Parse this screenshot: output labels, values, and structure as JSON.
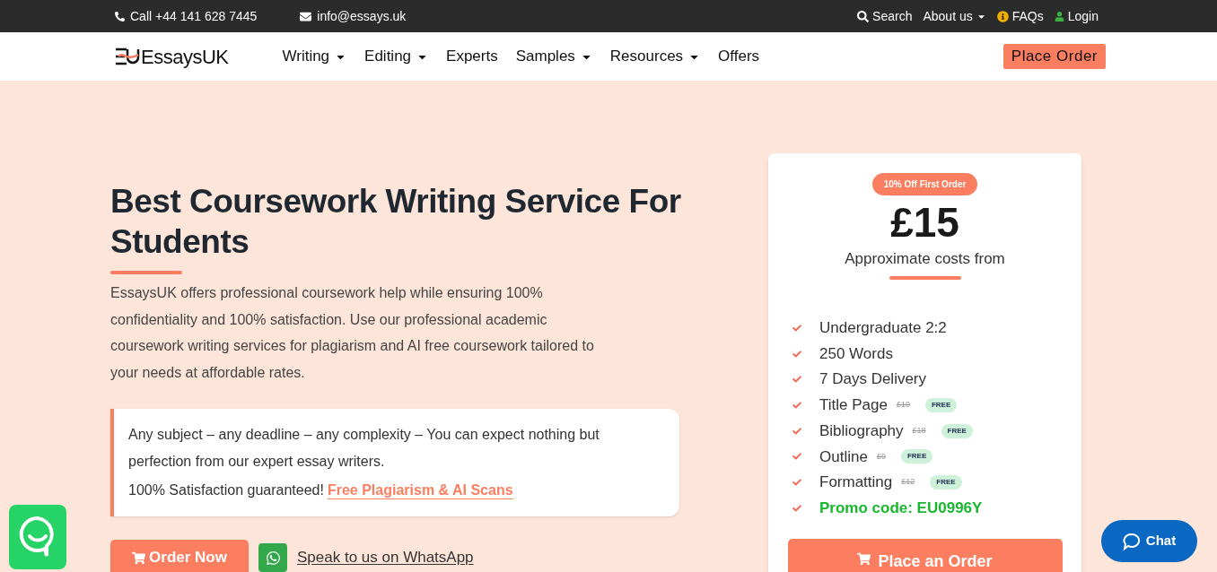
{
  "topbar": {
    "phone": "Call +44 141 628 7445",
    "email": "info@essays.uk",
    "links": [
      {
        "kind": "search",
        "label": "Search"
      },
      {
        "kind": "dropdown",
        "label": "About us"
      },
      {
        "kind": "info",
        "label": "FAQs"
      },
      {
        "kind": "user",
        "label": "Login"
      }
    ]
  },
  "nav": {
    "logo": "EssaysUK",
    "items": [
      {
        "label": "Writing",
        "dropdown": true
      },
      {
        "label": "Editing",
        "dropdown": true
      },
      {
        "label": "Experts",
        "dropdown": false
      },
      {
        "label": "Samples",
        "dropdown": true
      },
      {
        "label": "Resources",
        "dropdown": true
      },
      {
        "label": "Offers",
        "dropdown": false
      }
    ],
    "cta": "Place Order"
  },
  "hero": {
    "title": "Best Coursework Writing Service For Students",
    "intro": "EssaysUK offers professional coursework help while ensuring 100% confidentiality and 100% satisfaction. Use our professional academic coursework writing services for plagiarism and AI free coursework tailored to your needs at affordable rates.",
    "callout": "Any subject – any deadline – any complexity – You can expect nothing but perfection from our expert essay writers.",
    "guarantee": "100% Satisfaction guaranteed!",
    "guarantee_link": "Free Plagiarism & AI Scans",
    "order_button": "Order Now",
    "whatsapp": "Speak to us on WhatsApp"
  },
  "price_card": {
    "badge": "10% Off First Order",
    "price": "£15",
    "caption": "Approximate costs from",
    "features": [
      {
        "kind": "plain",
        "label": "Undergraduate 2:2"
      },
      {
        "kind": "plain",
        "label": "250 Words"
      },
      {
        "kind": "plain",
        "label": "7 Days Delivery"
      },
      {
        "kind": "extra",
        "label": "Title Page",
        "old_price": "£10",
        "tag": "FREE"
      },
      {
        "kind": "extra",
        "label": "Bibliography",
        "old_price": "£18",
        "tag": "FREE"
      },
      {
        "kind": "extra",
        "label": "Outline",
        "old_price": "£9",
        "tag": "FREE"
      },
      {
        "kind": "extra",
        "label": "Formatting",
        "old_price": "£12",
        "tag": "FREE"
      },
      {
        "kind": "promo",
        "label": "Promo code: EU0996Y"
      }
    ],
    "button": "Place an Order"
  },
  "chat": {
    "label": "Chat"
  }
}
